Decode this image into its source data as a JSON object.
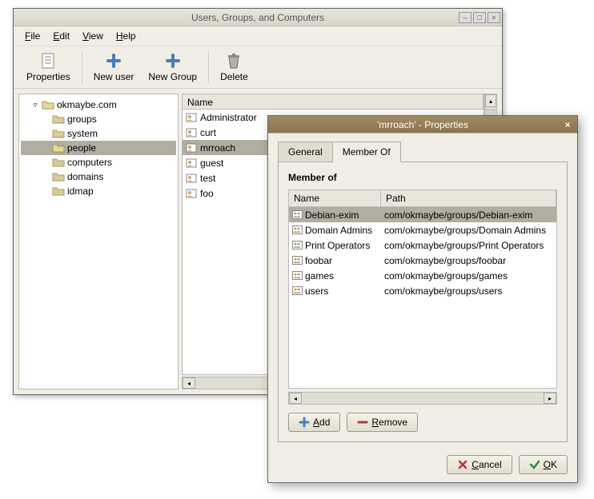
{
  "main_window": {
    "title": "Users, Groups, and Computers",
    "menubar": {
      "file": "File",
      "edit": "Edit",
      "view": "View",
      "help": "Help"
    },
    "toolbar": {
      "properties": "Properties",
      "new_user": "New user",
      "new_group": "New Group",
      "delete": "Delete"
    },
    "tree": {
      "root": "okmaybe.com",
      "children": [
        "groups",
        "system",
        "people",
        "computers",
        "domains",
        "idmap"
      ],
      "selected": "people"
    },
    "list": {
      "header": "Name",
      "rows": [
        "Administrator",
        "curt",
        "mrroach",
        "guest",
        "test",
        "foo"
      ],
      "selected": "mrroach"
    }
  },
  "dialog": {
    "title": "'mrroach' - Properties",
    "tabs": {
      "general": "General",
      "member_of": "Member Of",
      "active": "member_of"
    },
    "section_title": "Member of",
    "table": {
      "headers": {
        "name": "Name",
        "path": "Path"
      },
      "rows": [
        {
          "name": "Debian-exim",
          "path": "com/okmaybe/groups/Debian-exim"
        },
        {
          "name": "Domain Admins",
          "path": "com/okmaybe/groups/Domain Admins"
        },
        {
          "name": "Print Operators",
          "path": "com/okmaybe/groups/Print Operators"
        },
        {
          "name": "foobar",
          "path": "com/okmaybe/groups/foobar"
        },
        {
          "name": "games",
          "path": "com/okmaybe/groups/games"
        },
        {
          "name": "users",
          "path": "com/okmaybe/groups/users"
        }
      ],
      "selected": 0
    },
    "buttons": {
      "add": "Add",
      "remove": "Remove",
      "cancel": "Cancel",
      "ok": "OK"
    }
  }
}
